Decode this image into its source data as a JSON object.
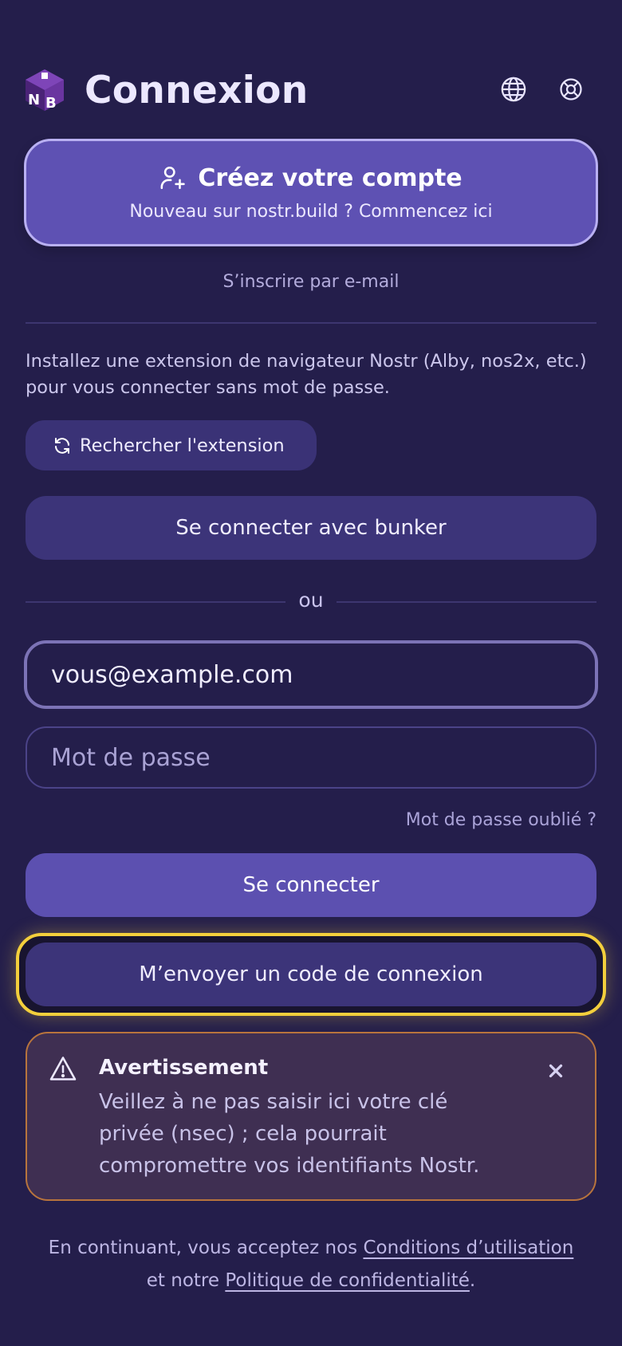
{
  "header": {
    "logo_text": "NB",
    "title": "Connexion",
    "icons": [
      "globe-icon",
      "lifebuoy-icon"
    ]
  },
  "create_account": {
    "title": "Créez votre compte",
    "subtitle": "Nouveau sur nostr.build ? Commencez ici",
    "icon": "user-plus-icon"
  },
  "email_signup_link": "S’inscrire par e-mail",
  "extension": {
    "description": "Installez une extension de navigateur Nostr (Alby, nos2x, etc.) pour vous connecter sans mot de passe.",
    "button_label": "Rechercher l'extension",
    "button_icon": "refresh-icon"
  },
  "bunker_button": "Se connecter avec bunker",
  "or_text": "ou",
  "form": {
    "email_value": "vous@example.com",
    "password_placeholder": "Mot de passe",
    "forgot_link": "Mot de passe oublié ?",
    "login_button": "Se connecter",
    "code_button": "M’envoyer un code de connexion"
  },
  "warning": {
    "title": "Avertissement",
    "text": "Veillez à ne pas saisir ici votre clé privée (nsec) ; cela pourrait compromettre vos identifiants Nostr.",
    "close": "×"
  },
  "footer": {
    "prefix": "En continuant, vous acceptez nos ",
    "terms": "Conditions d’utilisation",
    "middle": " et notre ",
    "privacy": "Politique de confidentialité",
    "suffix": "."
  },
  "colors": {
    "background": "#241e4b",
    "primary": "#5e51b3",
    "secondary": "#3c3479",
    "highlight": "#f3cf3c",
    "warning_border": "#b8743d"
  }
}
